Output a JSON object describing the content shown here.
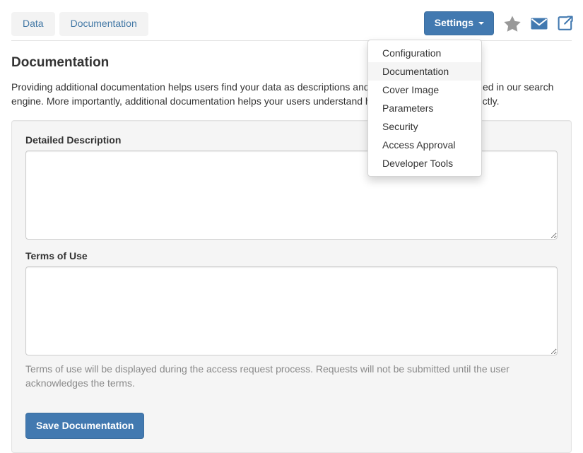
{
  "header": {
    "tabs": [
      {
        "label": "Data",
        "icon": ""
      },
      {
        "label": "Documentation",
        "icon": ""
      }
    ],
    "settings_button": {
      "label": "Settings",
      "caret_icon": "caret-down-icon"
    },
    "actions": [
      {
        "name": "favorite-star-icon",
        "title": "Favorite",
        "color": "#999999"
      },
      {
        "name": "envelope-icon",
        "title": "Contact",
        "color": "#4279b0"
      },
      {
        "name": "external-link-icon",
        "title": "Open in new window",
        "color": "#4279b0"
      }
    ]
  },
  "dropdown": {
    "open": true,
    "active_index": 1,
    "items": [
      {
        "label": "Configuration"
      },
      {
        "label": "Documentation"
      },
      {
        "label": "Cover Image"
      },
      {
        "label": "Parameters"
      },
      {
        "label": "Security"
      },
      {
        "label": "Access Approval"
      },
      {
        "label": "Developer Tools"
      }
    ]
  },
  "main": {
    "title": "Documentation",
    "lead": "Providing additional documentation helps users find your data as descriptions and documentation are included in our search engine. More importantly, additional documentation helps your users understand how to use your data correctly.",
    "form": {
      "detailed_description": {
        "label": "Detailed Description",
        "value": "",
        "placeholder": ""
      },
      "terms_of_use": {
        "label": "Terms of Use",
        "value": "",
        "placeholder": "",
        "help": "Terms of use will be displayed during the access request process. Requests will not be submitted until the user acknowledges the terms."
      },
      "save_button": "Save Documentation"
    }
  },
  "colors": {
    "primary": "#4279b0",
    "link": "#4479a6",
    "panel_bg": "#f5f5f5",
    "panel_border": "#e3e3e3",
    "muted_text": "#8a8a8a",
    "star_gray": "#999999"
  }
}
